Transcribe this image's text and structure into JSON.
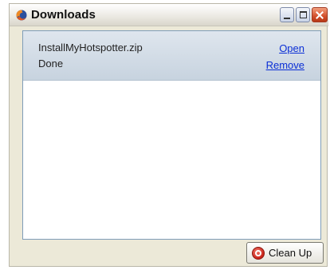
{
  "window": {
    "title": "Downloads",
    "app_icon": "firefox-icon",
    "controls": {
      "minimize_icon": "minimize-icon",
      "maximize_icon": "maximize-icon",
      "close_icon": "close-icon"
    }
  },
  "downloads": [
    {
      "file_name": "InstallMyHotspotter.zip",
      "status": "Done",
      "open_label": "Open",
      "remove_label": "Remove"
    }
  ],
  "footer": {
    "cleanup_label": "Clean Up",
    "cleanup_icon": "stop-icon"
  },
  "colors": {
    "link": "#0b2fd6",
    "item_bg": "#c7d3df",
    "window_bg": "#ece9d8"
  }
}
